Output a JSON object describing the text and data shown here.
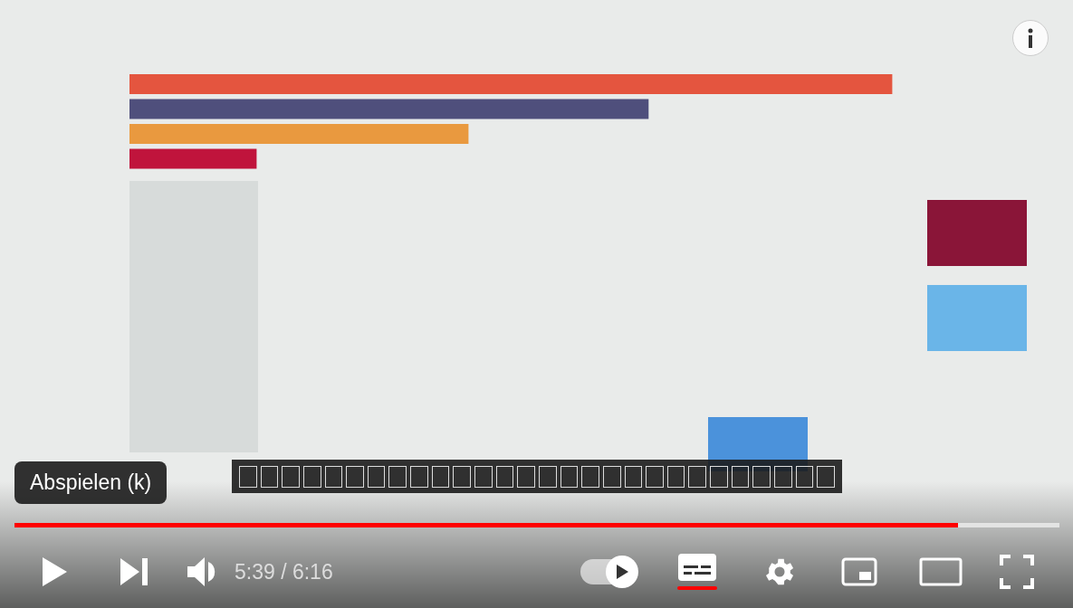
{
  "tooltip": "Abspielen (k)",
  "progress": {
    "level": 0.903
  },
  "time": "5:39 / 6:16",
  "autoplay": {
    "on": true
  },
  "subtitles": {
    "on": true
  }
}
